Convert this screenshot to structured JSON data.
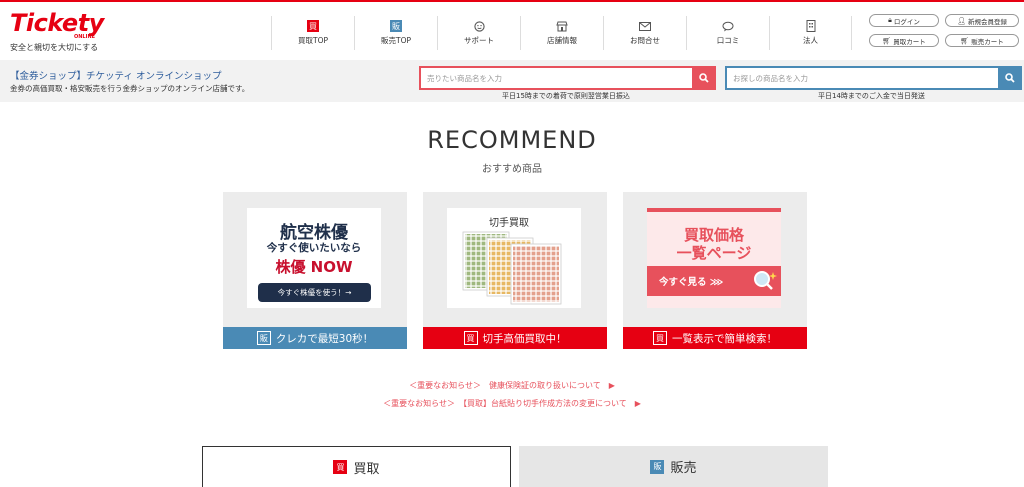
{
  "logo": {
    "brand": "Tickety",
    "online": "ONLINE",
    "tagline": "安全と親切を大切にする"
  },
  "nav": [
    {
      "label": "買取TOP",
      "icon_char": "買"
    },
    {
      "label": "販売TOP",
      "icon_char": "販"
    },
    {
      "label": "サポート",
      "icon_char": "☺"
    },
    {
      "label": "店舗情報",
      "icon_char": "⌂"
    },
    {
      "label": "お問合せ",
      "icon_char": "✉"
    },
    {
      "label": "口コミ",
      "icon_char": "💬"
    },
    {
      "label": "法人",
      "icon_char": "▯"
    }
  ],
  "account": {
    "login": "ログイン",
    "register": "新規会員登録",
    "buy_cart": "買取カート",
    "sell_cart": "販売カート"
  },
  "shop": {
    "name": "【金券ショップ】チケッティ オンラインショップ",
    "desc": "金券の高価買取・格安販売を行う金券ショップのオンライン店舗です。"
  },
  "search_sell": {
    "placeholder": "売りたい商品名を入力",
    "note": "平日15時までの着荷で原則翌営業日振込"
  },
  "search_buy": {
    "placeholder": "お探しの商品名を入力",
    "note": "平日14時までのご入金で当日発送"
  },
  "recommend": {
    "title": "RECOMMEND",
    "subtitle": "おすすめ商品",
    "cards": [
      {
        "line1": "航空株優",
        "line2": "今すぐ使いたいなら",
        "line3": "株優 NOW",
        "button": "今すぐ株優を使う！→",
        "tag": "販",
        "caption": "クレカで最短30秒！"
      },
      {
        "heading": "切手買取",
        "tag": "買",
        "caption": "切手高価買取中！"
      },
      {
        "line1": "買取価格",
        "line2": "一覧ページ",
        "button": "今すぐ見る ⋙",
        "tag": "買",
        "caption": "一覧表示で簡単検索！"
      }
    ]
  },
  "notices": [
    "＜重要なお知らせ＞　健康保険証の取り扱いについて　▶",
    "＜重要なお知らせ＞　【買取】台紙貼り切手作成方法の変更について　▶"
  ],
  "tabs": [
    {
      "tag": "買",
      "label": "買取"
    },
    {
      "tag": "販",
      "label": "販売"
    }
  ],
  "colors": {
    "brand_red": "#e60012",
    "accent_blue": "#4a8ab5",
    "search_red": "#e7515c",
    "navy": "#1f2f4a",
    "link_blue": "#2e5d9c"
  }
}
